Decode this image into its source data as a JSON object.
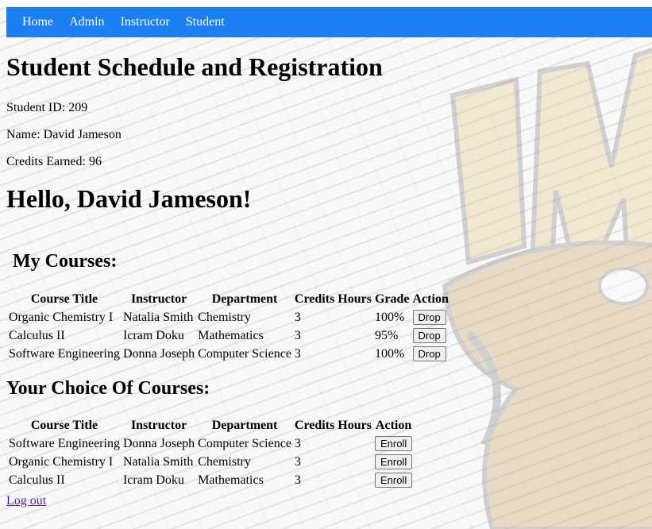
{
  "nav": {
    "items": [
      {
        "label": "Home"
      },
      {
        "label": "Admin"
      },
      {
        "label": "Instructor"
      },
      {
        "label": "Student"
      }
    ]
  },
  "page_title": "Student Schedule and Registration",
  "student": {
    "id_text": "Student ID: 209",
    "name_text": "Name: David Jameson",
    "credits_text": "Credits Earned: 96"
  },
  "greeting": "Hello, David Jameson!",
  "my_courses": {
    "heading": "My Courses:",
    "headers": [
      "Course Title",
      "Instructor",
      "Department",
      "Credits Hours",
      "Grade",
      "Action"
    ],
    "rows": [
      {
        "title": "Organic Chemistry I",
        "instructor": "Natalia Smith",
        "department": "Chemistry",
        "credits": "3",
        "grade": "100%",
        "action": "Drop"
      },
      {
        "title": "Calculus II",
        "instructor": "Icram Doku",
        "department": "Mathematics",
        "credits": "3",
        "grade": "95%",
        "action": "Drop"
      },
      {
        "title": "Software Engineering",
        "instructor": "Donna Joseph",
        "department": "Computer Science",
        "credits": "3",
        "grade": "100%",
        "action": "Drop"
      }
    ]
  },
  "choice_courses": {
    "heading": "Your Choice Of Courses:",
    "headers": [
      "Course Title",
      "Instructor",
      "Department",
      "Credits Hours",
      "Action"
    ],
    "rows": [
      {
        "title": "Software Engineering",
        "instructor": "Donna Joseph",
        "department": "Computer Science",
        "credits": "3",
        "action": "Enroll"
      },
      {
        "title": "Organic Chemistry I",
        "instructor": "Natalia Smith",
        "department": "Chemistry",
        "credits": "3",
        "action": "Enroll"
      },
      {
        "title": "Calculus II",
        "instructor": "Icram Doku",
        "department": "Mathematics",
        "credits": "3",
        "action": "Enroll"
      }
    ]
  },
  "logout_label": "Log out",
  "colors": {
    "nav_bg": "#1a7ff0",
    "link_visited": "#551a8b",
    "mascot_gold": "#e8c98a"
  }
}
